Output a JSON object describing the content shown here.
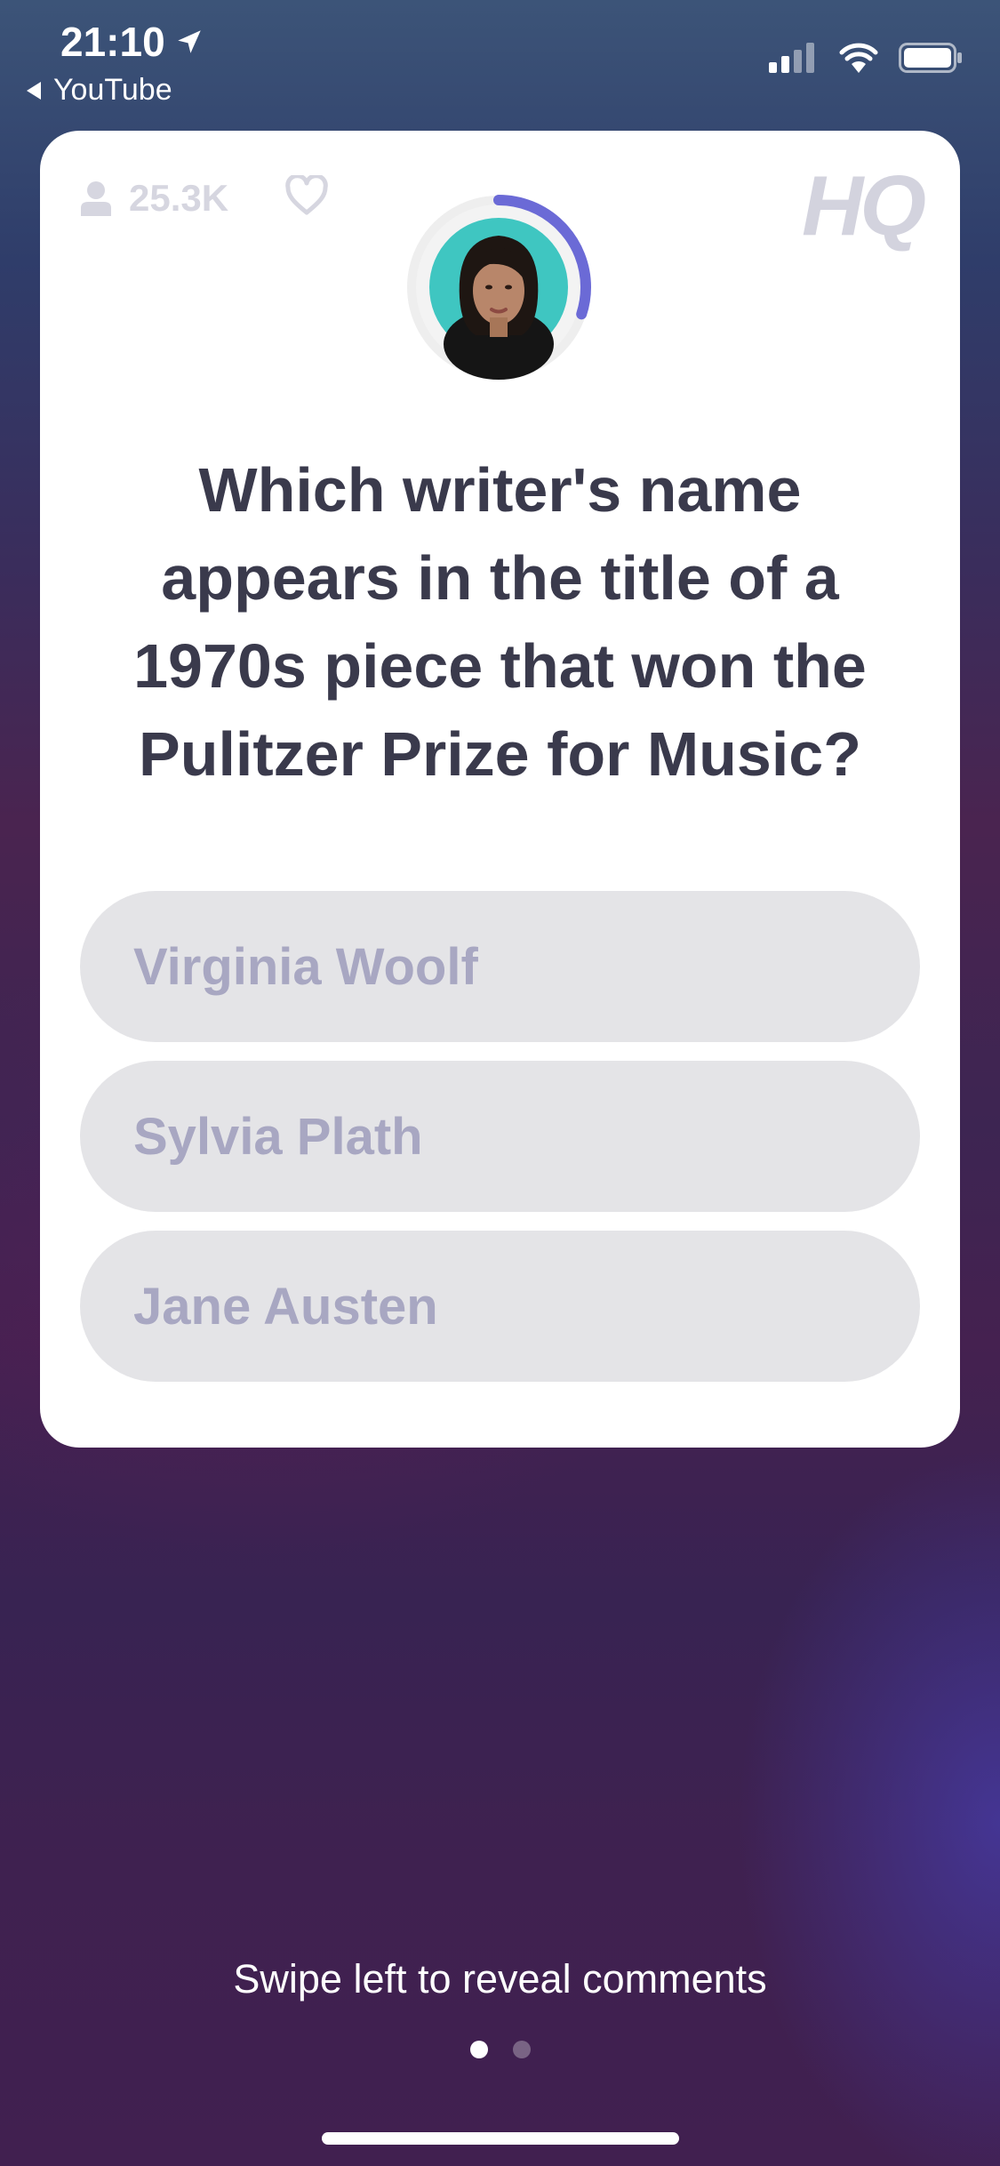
{
  "status_bar": {
    "time": "21:10",
    "back_label": "YouTube"
  },
  "card": {
    "viewer_count": "25.3K",
    "logo_text": "HQ",
    "timer_progress": 0.3,
    "question": "Which writer's name appears in the title of a 1970s piece that won the Pulitzer Prize for Music?",
    "answers": [
      {
        "label": "Virginia Woolf"
      },
      {
        "label": "Sylvia Plath"
      },
      {
        "label": "Jane Austen"
      }
    ]
  },
  "footer": {
    "swipe_hint": "Swipe left to reveal comments",
    "page_dots": {
      "count": 2,
      "active_index": 0
    }
  },
  "colors": {
    "timer_ring": "#6b6ad6",
    "answer_bg": "#e4e4e7",
    "answer_text": "#a8a7c2"
  }
}
